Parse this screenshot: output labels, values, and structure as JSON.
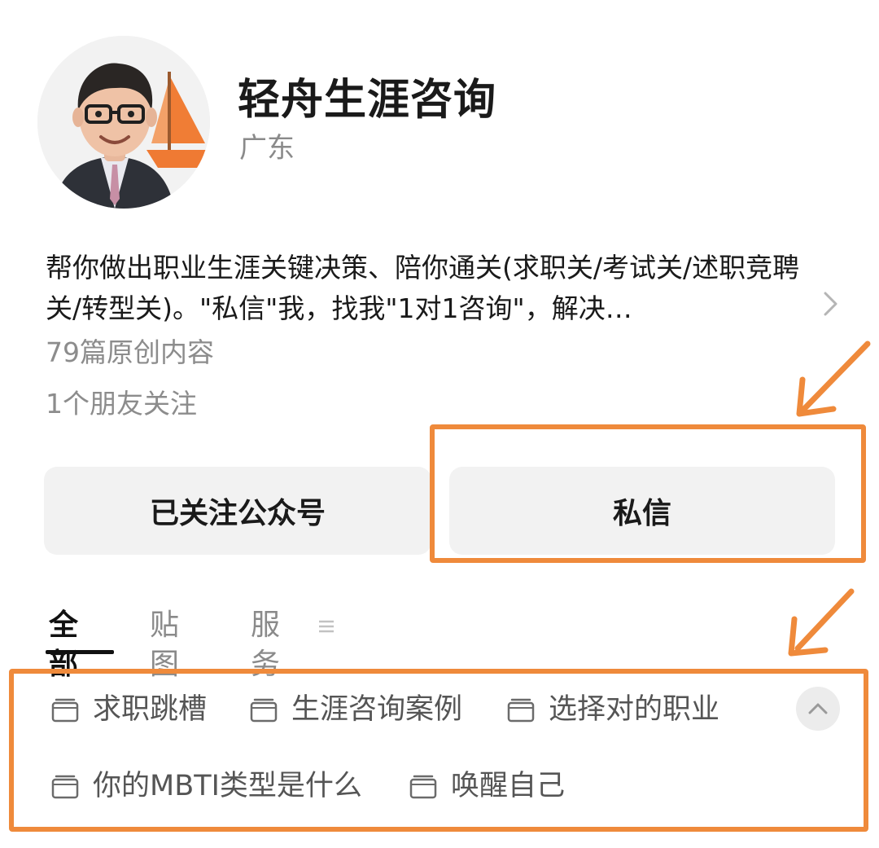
{
  "profile": {
    "name": "轻舟生涯咨询",
    "region": "广东",
    "bio": "帮你做出职业生涯关键决策、陪你通关(求职关/考试关/述职竞聘关/转型关)。\"私信\"我，找我\"1对1咨询\"，解决…",
    "articles_count": "79篇原创内容",
    "friends_following": "1个朋友关注"
  },
  "actions": {
    "follow_label": "已关注公众号",
    "message_label": "私信"
  },
  "tabs": [
    {
      "label": "全部",
      "active": true
    },
    {
      "label": "贴图",
      "active": false
    },
    {
      "label": "服务",
      "active": false
    }
  ],
  "collections": [
    {
      "label": "求职跳槽"
    },
    {
      "label": "生涯咨询案例"
    },
    {
      "label": "选择对的职业"
    },
    {
      "label": "你的MBTI类型是什么"
    },
    {
      "label": "唤醒自己"
    }
  ],
  "colors": {
    "highlight": "#ef8a3b",
    "button_bg": "#f2f2f2",
    "text_primary": "#1a1a1a",
    "text_secondary": "#8a8a8a"
  },
  "icons": {
    "bio_expand": "chevron-right-icon",
    "tab_menu": "menu-icon",
    "collection": "folder-icon",
    "collapse": "chevron-up-icon"
  }
}
